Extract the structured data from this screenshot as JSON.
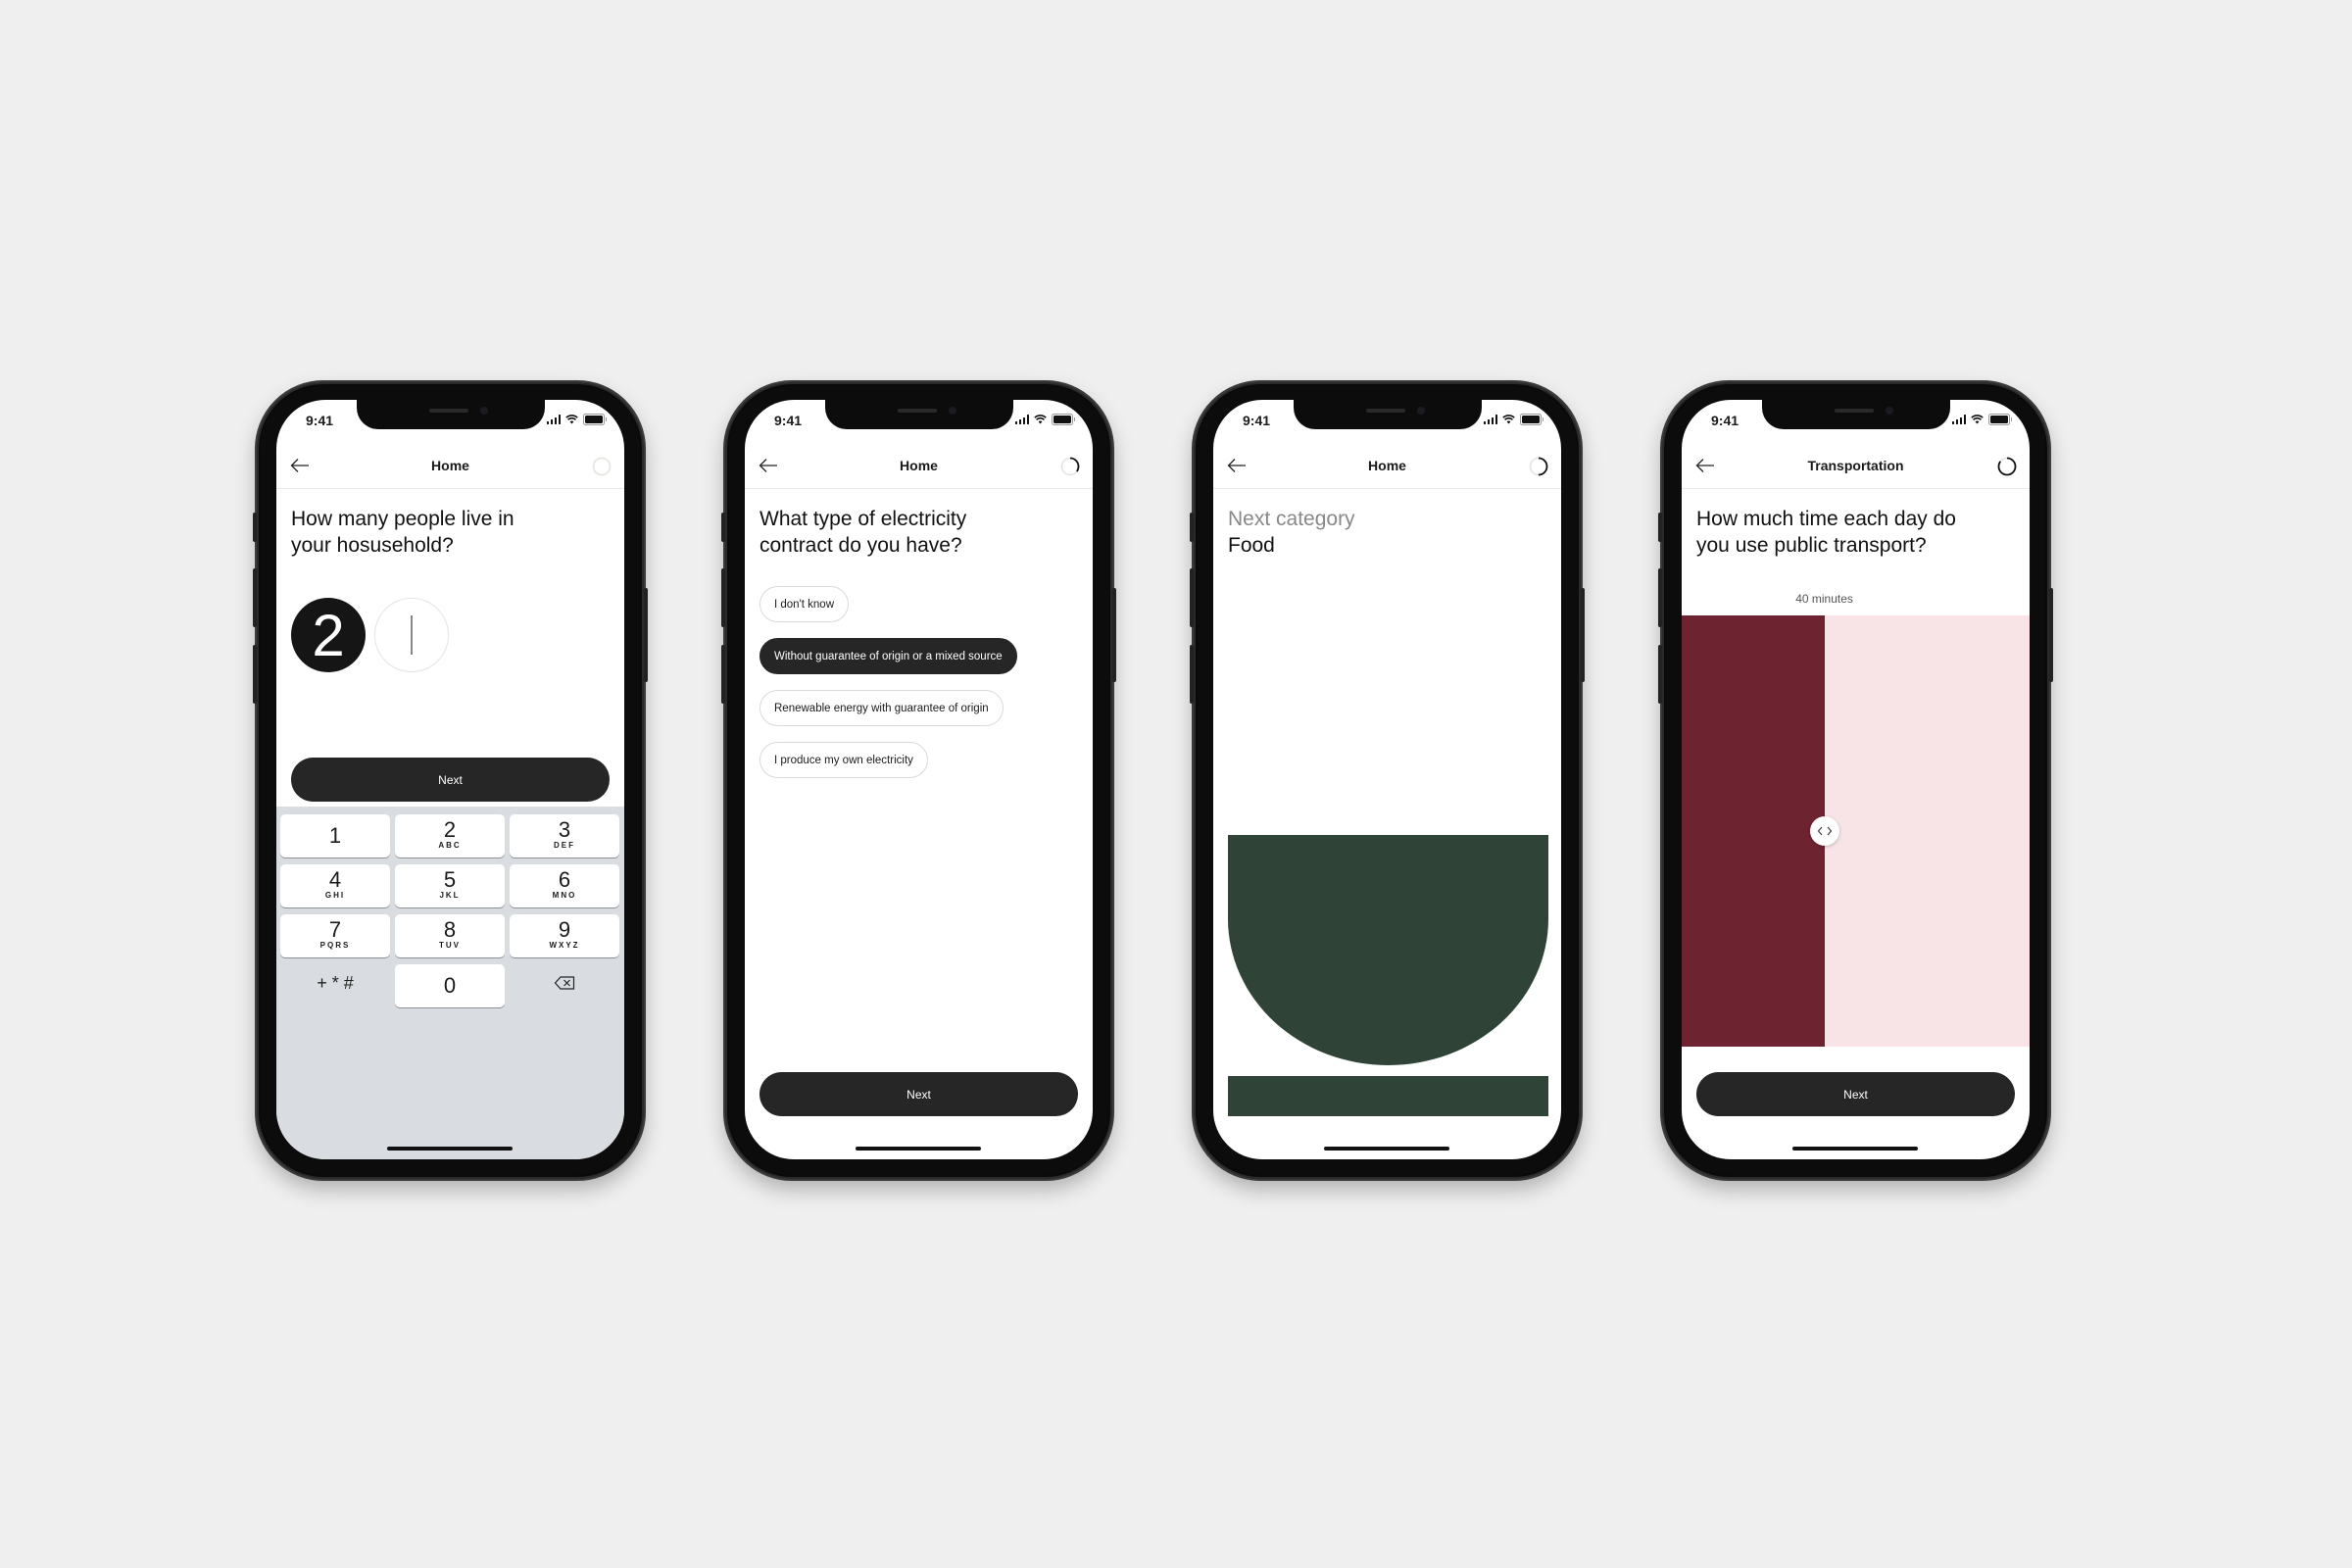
{
  "status_bar": {
    "time": "9:41"
  },
  "phones": [
    {
      "nav": {
        "title": "Home",
        "progress": 0.0
      },
      "question": [
        "How many people live in",
        "your hosusehold?"
      ],
      "input": {
        "value": "2",
        "empty_slot": ""
      },
      "next_label": "Next",
      "keypad": {
        "keys": [
          {
            "num": "1",
            "letters": ""
          },
          {
            "num": "2",
            "letters": "ABC"
          },
          {
            "num": "3",
            "letters": "DEF"
          },
          {
            "num": "4",
            "letters": "GHI"
          },
          {
            "num": "5",
            "letters": "JKL"
          },
          {
            "num": "6",
            "letters": "MNO"
          },
          {
            "num": "7",
            "letters": "PQRS"
          },
          {
            "num": "8",
            "letters": "TUV"
          },
          {
            "num": "9",
            "letters": "WXYZ"
          }
        ],
        "symbols": "+ * #",
        "zero": "0",
        "delete_icon": "backspace-icon"
      }
    },
    {
      "nav": {
        "title": "Home",
        "progress": 0.35
      },
      "question": [
        "What type of electricity",
        "contract do you have?"
      ],
      "options": [
        {
          "label": "I don't know",
          "selected": false
        },
        {
          "label": "Without guarantee of origin or a mixed source",
          "selected": true
        },
        {
          "label": "Renewable energy with guarantee of origin",
          "selected": false
        },
        {
          "label": "I produce my own electricity",
          "selected": false
        }
      ],
      "next_label": "Next"
    },
    {
      "nav": {
        "title": "Home",
        "progress": 0.5
      },
      "eyebrow": "Next category",
      "category": "Food",
      "illustration_color": "#2f4437"
    },
    {
      "nav": {
        "title": "Transportation",
        "progress": 0.85
      },
      "question": [
        "How much time each day do",
        "you use public transport?"
      ],
      "slider": {
        "value_label": "40 minutes",
        "fraction": 0.41,
        "fill_color": "#6e2330",
        "track_color": "#f8e4e7",
        "handle_icon": "chevrons-left-right-icon"
      },
      "next_label": "Next"
    }
  ]
}
